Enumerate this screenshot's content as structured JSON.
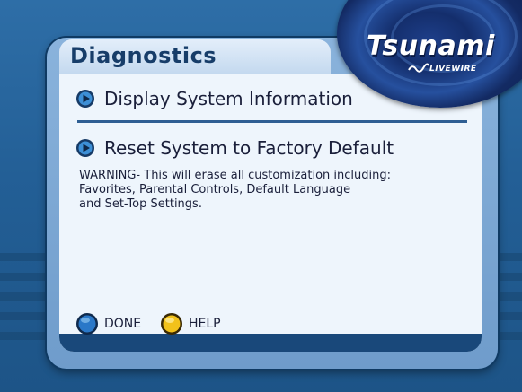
{
  "screen": {
    "title": "Diagnostics",
    "brand": {
      "name": "Tsunami",
      "sub": "LIVEWIRE"
    },
    "menu": [
      {
        "label": "Display System Information",
        "icon": "blue-play-bullet-icon"
      },
      {
        "label": "Reset System to Factory Default",
        "icon": "blue-play-bullet-icon"
      }
    ],
    "warning": "WARNING- This will erase all customization including:\nFavorites, Parental Controls, Default Language\nand Set-Top Settings.",
    "footer": {
      "done_label": "DONE",
      "help_label": "HELP",
      "done_icon": "blue-circle-button-icon",
      "help_icon": "yellow-circle-button-icon"
    }
  },
  "colors": {
    "background": "#235f96",
    "panel": "#eef5fc",
    "title": "#173d69",
    "divider": "#2e5e93",
    "done_button": "#2a78c8",
    "help_button": "#f2c21b"
  }
}
